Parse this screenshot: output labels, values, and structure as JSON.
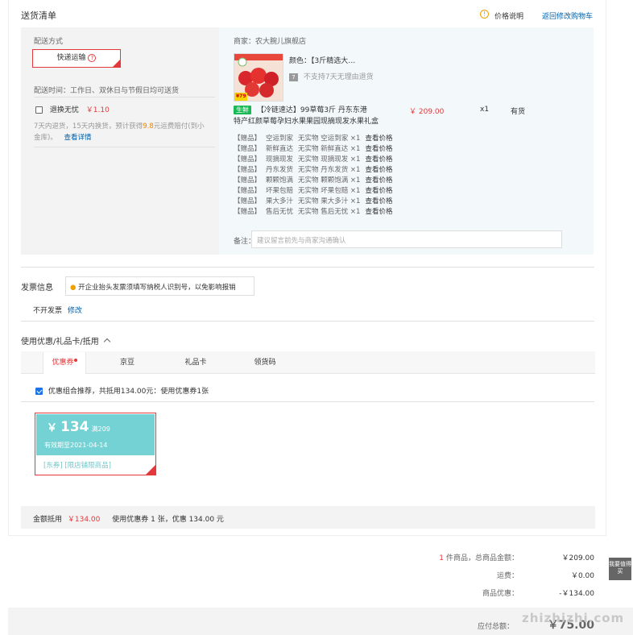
{
  "section": {
    "title": "送货清单",
    "price_note": "价格说明",
    "back_cart": "返回修改购物车"
  },
  "shipping": {
    "label": "配送方式",
    "method": "快递运输",
    "time": "配送时间：工作日、双休日与节假日均可送货",
    "insurance_label": "退换无忧",
    "insurance_price": "￥1.10",
    "insurance_desc_1": "7天内退货，15天内换货，预计获得",
    "insurance_desc_amount": "9.8",
    "insurance_desc_2": "元运费赔付(到小",
    "insurance_desc_3": "金库)。",
    "insurance_detail": "查看详情"
  },
  "order": {
    "merchant": "商家：农大腕儿旗舰店",
    "color": "颜色：【3斤精选大…",
    "no_return": "不支持7天无理由退货",
    "badge": "生鲜",
    "name_line1": "【冷链速达】99草莓3斤 丹东东港",
    "name_line2": "特产红颜草莓孕妇水果果园现摘现发水果礼盒",
    "price": "￥ 209.00",
    "qty": "x1",
    "stock": "有货",
    "thumb_tag": "¥79",
    "gifts": [
      {
        "tag": "【赠品】",
        "name": "空运到家",
        "desc": "无实物 空运到家 ×1",
        "link": "查看价格"
      },
      {
        "tag": "【赠品】",
        "name": "新鲜直达",
        "desc": "无实物 新鲜直达 ×1",
        "link": "查看价格"
      },
      {
        "tag": "【赠品】",
        "name": "现摘现发",
        "desc": "无实物 现摘现发 ×1",
        "link": "查看价格"
      },
      {
        "tag": "【赠品】",
        "name": "丹东发货",
        "desc": "无实物 丹东发货 ×1",
        "link": "查看价格"
      },
      {
        "tag": "【赠品】",
        "name": "颗颗饱满",
        "desc": "无实物 颗颗饱满 ×1",
        "link": "查看价格"
      },
      {
        "tag": "【赠品】",
        "name": "坏果包赔",
        "desc": "无实物 坏果包赔 ×1",
        "link": "查看价格"
      },
      {
        "tag": "【赠品】",
        "name": "果大多汁",
        "desc": "无实物 果大多汁 ×1",
        "link": "查看价格"
      },
      {
        "tag": "【赠品】",
        "name": "售后无忧",
        "desc": "无实物 售后无忧 ×1",
        "link": "查看价格"
      }
    ],
    "remark_label": "备注：",
    "remark_placeholder": "建议留言前先与商家沟通确认"
  },
  "invoice": {
    "title": "发票信息",
    "tip": "开企业抬头发票须填写纳税人识别号，以免影响报销",
    "status": "不开发票",
    "edit": "修改"
  },
  "coupon": {
    "title": "使用优惠/礼品卡/抵用",
    "tabs": [
      "优惠券",
      "京豆",
      "礼品卡",
      "领货码"
    ],
    "combo_text": "优惠组合推荐，共抵用134.00元：使用优惠券1张",
    "card_currency": "￥",
    "card_amount": "134",
    "card_condition": "满209",
    "card_expire": "有效期至2021-04-14",
    "card_tags": "[东券] [限店铺限商品]",
    "summary_label": "金额抵用",
    "summary_amount": "￥134.00",
    "summary_desc": "使用优惠券 1 张，优惠 134.00 元"
  },
  "totals": {
    "count_prefix": "1",
    "count_suffix": "件商品，总商品金额：",
    "goods_amount": "￥209.00",
    "freight_label": "运费：",
    "freight": "￥0.00",
    "discount_label": "商品优惠：",
    "discount": "-￥134.00",
    "payable_label": "应付总额：",
    "payable": "￥75.00"
  },
  "watermark": {
    "text": "zhizhizhi.com",
    "badge": "我要值得买"
  }
}
